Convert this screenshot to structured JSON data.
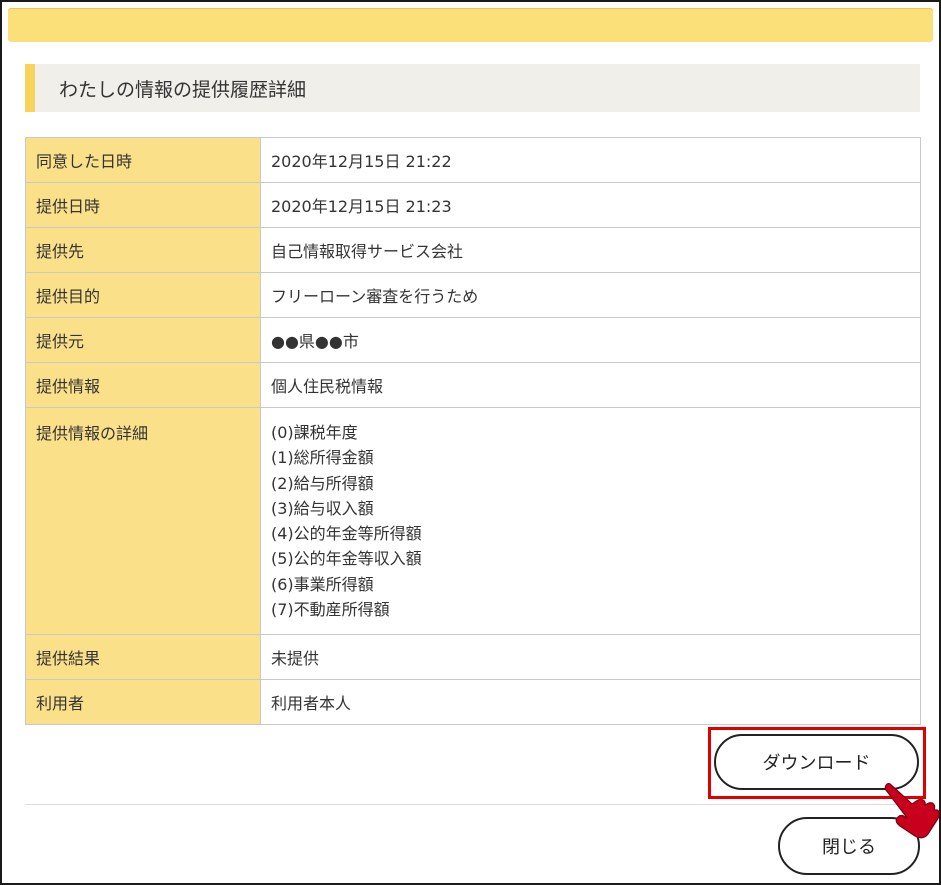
{
  "page": {
    "title": "わたしの情報の提供履歴詳細"
  },
  "details": [
    {
      "label": "同意した日時",
      "value": "2020年12月15日 21:22"
    },
    {
      "label": "提供日時",
      "value": "2020年12月15日 21:23"
    },
    {
      "label": "提供先",
      "value": "自己情報取得サービス会社"
    },
    {
      "label": "提供目的",
      "value": "フリーローン審査を行うため"
    },
    {
      "label": "提供元",
      "value": "●●県●●市"
    },
    {
      "label": "提供情報",
      "value": "個人住民税情報"
    },
    {
      "label": "提供情報の詳細",
      "items": [
        "(0)課税年度",
        "(1)総所得金額",
        "(2)給与所得額",
        "(3)給与収入額",
        "(4)公的年金等所得額",
        "(5)公的年金等収入額",
        "(6)事業所得額",
        "(7)不動産所得額"
      ]
    },
    {
      "label": "提供結果",
      "value": "未提供"
    },
    {
      "label": "利用者",
      "value": "利用者本人"
    }
  ],
  "actions": {
    "download_label": "ダウンロード",
    "close_label": "閉じる"
  },
  "icons": {
    "pointer": "hand-pointer-icon"
  },
  "colors": {
    "header_bar": "#fbe07a",
    "label_cell": "#fbe08a",
    "title_accent": "#f6d35a",
    "highlight": "#e00000",
    "cursor": "#c8001e"
  }
}
